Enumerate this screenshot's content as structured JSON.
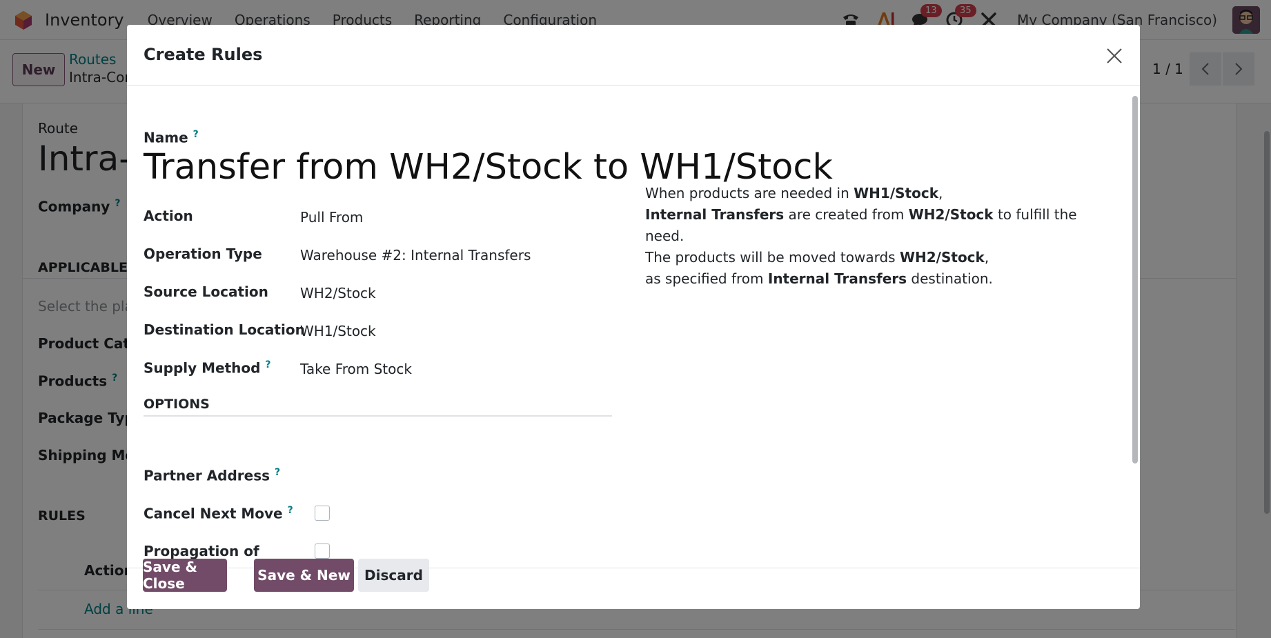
{
  "navbar": {
    "app_name": "Inventory",
    "menu": [
      "Overview",
      "Operations",
      "Products",
      "Reporting",
      "Configuration"
    ],
    "messages_count": "13",
    "activities_count": "35",
    "company": "My Company (San Francisco)",
    "icons": [
      "phone-icon",
      "ai-icon",
      "chat-icon",
      "clock-icon",
      "tools-icon"
    ]
  },
  "control_panel": {
    "new_label": "New",
    "breadcrumb_parent": "Routes",
    "breadcrumb_current": "Intra-Com",
    "pager": "1 / 1"
  },
  "background_form": {
    "route_label": "Route",
    "route_title": "Intra-C",
    "company_label": "Company",
    "applicable_on": "APPLICABLE O",
    "select_hint": "Select the pla",
    "product_categories": "Product Cate",
    "products": "Products",
    "package_type": "Package Type",
    "shipping_method": "Shipping Met",
    "rules": "RULES",
    "action_col": "Action",
    "add_line": "Add a line"
  },
  "modal": {
    "title": "Create Rules",
    "name_label": "Name",
    "name_value": "Transfer from WH2/Stock to WH1/Stock",
    "fields": [
      {
        "label": "Action",
        "value": "Pull From"
      },
      {
        "label": "Operation Type",
        "value": "Warehouse #2: Internal Transfers"
      },
      {
        "label": "Source Location",
        "value": "WH2/Stock"
      },
      {
        "label": "Destination Location",
        "value": "WH1/Stock"
      },
      {
        "label": "Supply Method",
        "value": "Take From Stock"
      }
    ],
    "help": {
      "l1_a": "When products are needed in ",
      "l1_b": "WH1/Stock",
      "l1_c": ",",
      "l2_a": "Internal Transfers",
      "l2_b": " are created from ",
      "l2_c": "WH2/Stock",
      "l2_d": " to fulfill the need.",
      "l3_a": "The products will be moved towards ",
      "l3_b": "WH2/Stock",
      "l3_c": ",",
      "l4_a": "as specified from ",
      "l4_b": "Internal Transfers",
      "l4_c": " destination."
    },
    "options_heading": "OPTIONS",
    "partner_address_label": "Partner Address",
    "cancel_next_move_label": "Cancel Next Move",
    "cancel_next_move_checked": false,
    "propagation_label": "Propagation of",
    "propagation_checked": false,
    "help_marker": "?",
    "buttons": {
      "save_close": "Save & Close",
      "save_new": "Save & New",
      "discard": "Discard"
    }
  },
  "colors": {
    "primary": "#714b67",
    "link": "#017e84",
    "badge": "#d23f4b"
  }
}
